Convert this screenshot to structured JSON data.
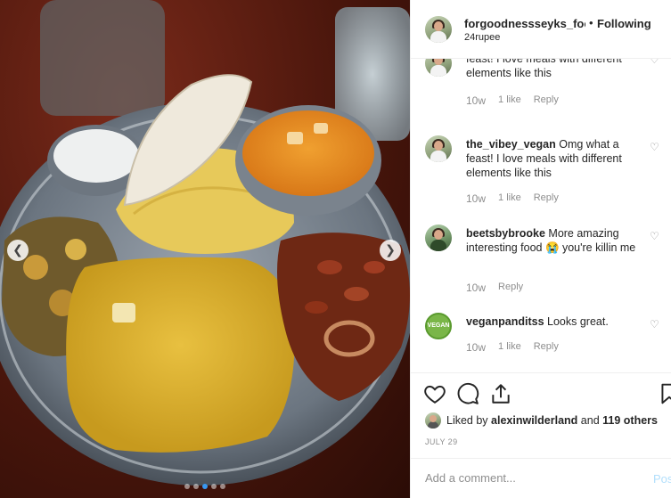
{
  "photo": {
    "dots": [
      false,
      false,
      true,
      false,
      false
    ]
  },
  "header": {
    "username": "forgoodnessseyks_food",
    "separator": "•",
    "follow_label": "Following",
    "location": "24rupee"
  },
  "comments": [
    {
      "user": "the_vibey_vegan",
      "text": "Omg what a feast! I love meals with different elements like this",
      "time": "10w",
      "likes": "1 like",
      "reply": "Reply",
      "partial": true
    },
    {
      "user": "the_vibey_vegan",
      "text": "Omg what a feast! I love meals with different elements like this",
      "time": "10w",
      "likes": "1 like",
      "reply": "Reply"
    },
    {
      "user": "beetsbybrooke",
      "text": "More amazing interesting food 😭 you're killin me",
      "time": "10w",
      "reply": "Reply"
    },
    {
      "user": "veganpanditss",
      "text": "Looks great.",
      "time": "10w",
      "likes": "1 like",
      "reply": "Reply"
    }
  ],
  "partial_comment_text": "feast! I love meals with different elements like this",
  "icons": {
    "like": "heart-icon",
    "comment": "comment-icon",
    "share": "share-icon",
    "save": "bookmark-icon",
    "comment_like": "heart-outline-icon",
    "prev": "chevron-left-icon",
    "next": "chevron-right-icon"
  },
  "likes": {
    "prefix": "Liked by",
    "user": "alexinwilderland",
    "middle": "and",
    "others": "119 others"
  },
  "date": "JULY 29",
  "add_comment": {
    "placeholder": "Add a comment...",
    "post_label": "Post"
  },
  "badge_text": "VEGAN",
  "colors": {
    "link_blue": "#3897f0",
    "post_disabled": "#b2dffc",
    "muted": "#8e8e8e"
  }
}
